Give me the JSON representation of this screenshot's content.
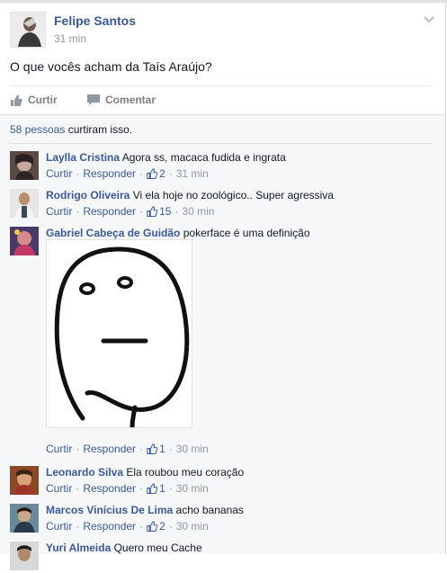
{
  "post": {
    "author": "Felipe Santos",
    "time": "31 min",
    "text": "O que vocês acham da Taís Araújo?",
    "actions": {
      "like": "Curtir",
      "comment": "Comentar"
    }
  },
  "likes": {
    "count_text": "58 pessoas",
    "suffix": "curtiram isso."
  },
  "comment_actions": {
    "like": "Curtir",
    "reply": "Responder"
  },
  "comments": [
    {
      "name": "Laylla Cristina",
      "text": "Agora ss, macaca fudida e ingrata",
      "likes": "2",
      "time": "31 min"
    },
    {
      "name": "Rodrigo Oliveira",
      "text": "Vi ela hoje no zoológico.. Super agressiva",
      "likes": "15",
      "time": "30 min"
    },
    {
      "name": "Gabriel Cabeça de Guidão",
      "text": "pokerface é uma definição",
      "likes": "1",
      "time": "30 min"
    },
    {
      "name": "Leonardo Silva",
      "text": "Ela roubou meu coração",
      "likes": "1",
      "time": "30 min"
    },
    {
      "name": "Marcos Vinícius De Lima",
      "text": "acho bananas",
      "likes": "2",
      "time": "30 min"
    },
    {
      "name": "Yuri Almeida",
      "text": "Quero meu Cache"
    }
  ],
  "colors": {
    "link": "#3b5998",
    "meta": "#9197a3",
    "background": "#f6f7f8"
  },
  "icons": [
    "chevron-down-icon",
    "like-thumb-icon",
    "comment-bubble-icon",
    "like-count-thumb-icon"
  ]
}
